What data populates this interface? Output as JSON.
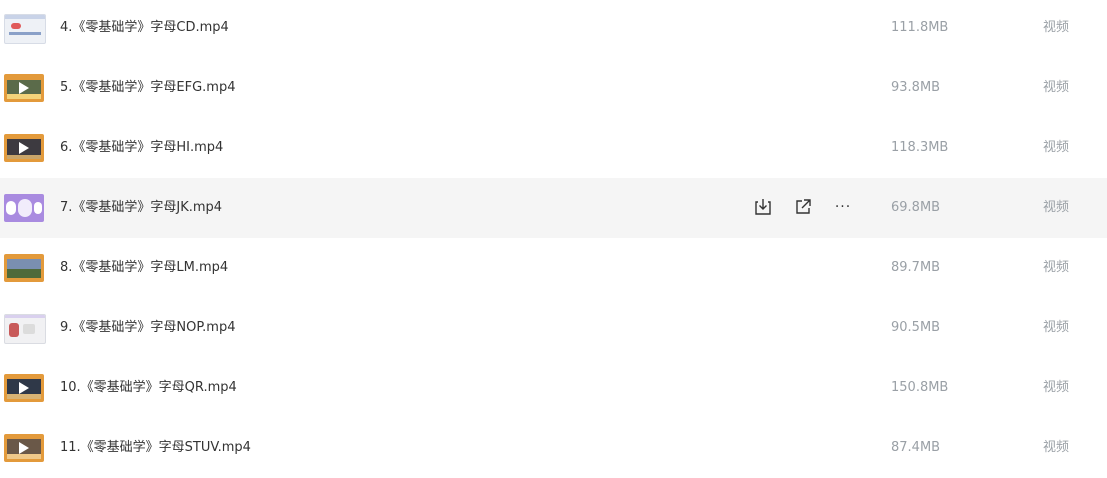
{
  "files": [
    {
      "name": "4.《零基础学》字母CD.mp4",
      "size": "111.8MB",
      "type": "视频",
      "thumb": "light"
    },
    {
      "name": "5.《零基础学》字母EFG.mp4",
      "size": "93.8MB",
      "type": "视频",
      "thumb": "orange-play"
    },
    {
      "name": "6.《零基础学》字母HI.mp4",
      "size": "118.3MB",
      "type": "视频",
      "thumb": "orange-play"
    },
    {
      "name": "7.《零基础学》字母JK.mp4",
      "size": "69.8MB",
      "type": "视频",
      "thumb": "purple"
    },
    {
      "name": "8.《零基础学》字母LM.mp4",
      "size": "89.7MB",
      "type": "视频",
      "thumb": "orange"
    },
    {
      "name": "9.《零基础学》字母NOP.mp4",
      "size": "90.5MB",
      "type": "视频",
      "thumb": "light"
    },
    {
      "name": "10.《零基础学》字母QR.mp4",
      "size": "150.8MB",
      "type": "视频",
      "thumb": "orange-play"
    },
    {
      "name": "11.《零基础学》字母STUV.mp4",
      "size": "87.4MB",
      "type": "视频",
      "thumb": "orange-play"
    }
  ],
  "hover_row": 3,
  "hover_actions": [
    {
      "icon": "download-icon"
    },
    {
      "icon": "share-icon"
    },
    {
      "icon": "more-icon",
      "label": "···"
    }
  ],
  "colors": {
    "hover_background": "#f5f5f5",
    "name_text": "#333333",
    "meta_text": "#9aa0a6",
    "thumb_orange": "#e39a3b",
    "thumb_purple": "#a98be0"
  }
}
